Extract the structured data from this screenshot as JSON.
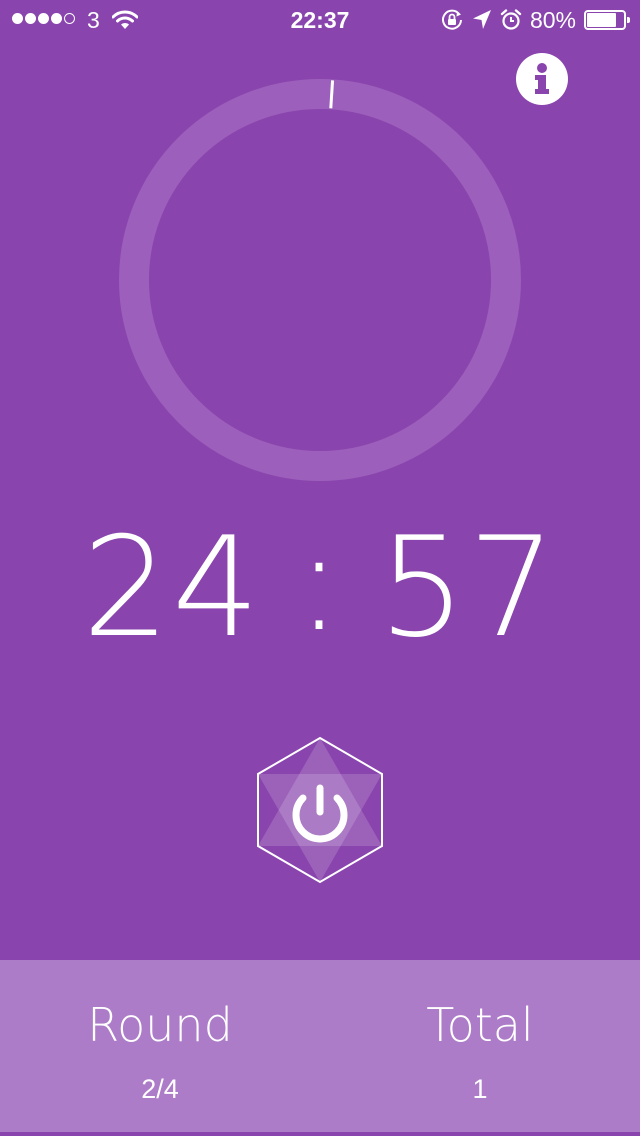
{
  "status_bar": {
    "carrier": "3",
    "time": "22:37",
    "battery_percent": "80%",
    "battery_level": 0.8,
    "signal_bars_filled": 4,
    "signal_bars_total": 5
  },
  "timer": {
    "minutes": "24",
    "separator": ":",
    "seconds": "57",
    "progress": 0.01
  },
  "icons": {
    "info": "info-icon",
    "power": "power-icon"
  },
  "footer": {
    "round": {
      "label": "Round",
      "value": "2/4"
    },
    "total": {
      "label": "Total",
      "value": "1"
    }
  },
  "colors": {
    "background": "#8944ad",
    "footer": "#ad7cc8",
    "ring_track": "#9c5fbb",
    "foreground": "#ffffff"
  }
}
